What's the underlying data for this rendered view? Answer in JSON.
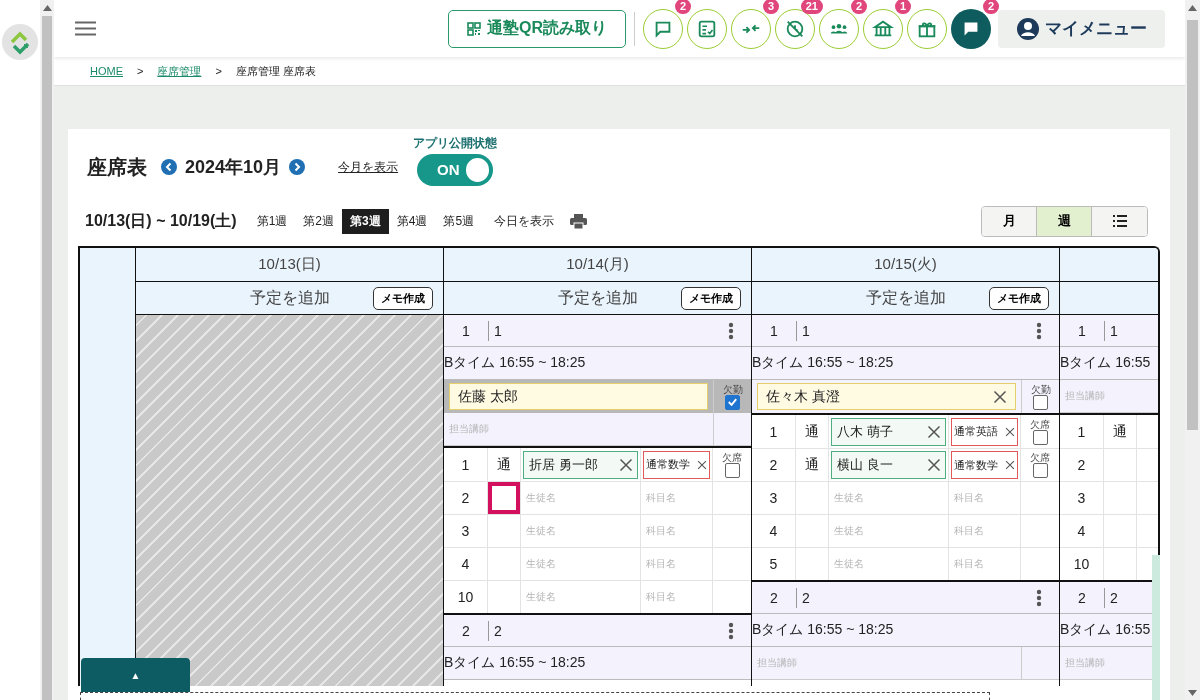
{
  "header": {
    "qr_button": "通塾QR読み取り",
    "icon_buttons": [
      {
        "kind": "outline",
        "badge": "2"
      },
      {
        "kind": "outline"
      },
      {
        "kind": "outline",
        "badge": "3"
      },
      {
        "kind": "outline",
        "badge": "21"
      },
      {
        "kind": "outline",
        "badge": "2"
      },
      {
        "kind": "outline",
        "badge": "1"
      },
      {
        "kind": "outline"
      },
      {
        "kind": "filled",
        "badge": "2"
      }
    ],
    "my_menu": "マイメニュー"
  },
  "breadcrumb": [
    {
      "kind": "link",
      "text": "HOME"
    },
    {
      "kind": "separator",
      "text": ">"
    },
    {
      "kind": "link",
      "text": "座席管理"
    },
    {
      "kind": "separator",
      "text": ">"
    },
    {
      "kind": "current",
      "text": "座席管理 座席表"
    }
  ],
  "page": {
    "title": "座席表",
    "month": "2024年10月",
    "this_month_link": "今月を表示",
    "publish": {
      "label": "アプリ公開状態",
      "on": true,
      "text": "ON"
    }
  },
  "week_bar": {
    "range": "10/13(日) ~ 10/19(土)",
    "weeks": [
      {
        "label": "第1週",
        "selected": false
      },
      {
        "label": "第2週",
        "selected": false
      },
      {
        "label": "第3週",
        "selected": true
      },
      {
        "label": "第4週",
        "selected": false
      },
      {
        "label": "第5週",
        "selected": false
      }
    ],
    "today_link": "今日を表示",
    "views": [
      {
        "kind": "text",
        "label": "月",
        "selected": false
      },
      {
        "kind": "text",
        "label": "週",
        "selected": true
      },
      {
        "kind": "icon",
        "selected": false
      }
    ]
  },
  "table": {
    "days": [
      {
        "date": "10/13(日)",
        "add_label": "予定を追加",
        "memo_button": "メモ作成",
        "closed": true
      },
      {
        "date": "10/14(月)",
        "add_label": "予定を追加",
        "memo_button": "メモ作成",
        "closed": false,
        "rows": [
          {
            "kind": "slot",
            "number": "1",
            "name": "1",
            "menu": true
          },
          {
            "kind": "time",
            "text": "Bタイム 16:55 ~ 18:25"
          },
          {
            "kind": "teacher",
            "name": "佐藤 太郎",
            "clear": false,
            "absence_label": "欠勤",
            "absent": true
          },
          {
            "kind": "teacher-placeholder",
            "placeholder": "担当講師"
          },
          {
            "kind": "student",
            "number": "1",
            "type": "通",
            "student": "折居 勇一郎",
            "subject": "通常数学",
            "absence_label": "欠席",
            "absent": false,
            "focused": false
          },
          {
            "kind": "student",
            "number": "2",
            "student_placeholder": "生徒名",
            "subject_placeholder": "科目名",
            "focused": true
          },
          {
            "kind": "student",
            "number": "3",
            "student_placeholder": "生徒名",
            "subject_placeholder": "科目名",
            "focused": false
          },
          {
            "kind": "student",
            "number": "4",
            "student_placeholder": "生徒名",
            "subject_placeholder": "科目名",
            "focused": false
          },
          {
            "kind": "student",
            "number": "10",
            "student_placeholder": "生徒名",
            "subject_placeholder": "科目名",
            "focused": false
          },
          {
            "kind": "slot",
            "number": "2",
            "name": "2",
            "menu": true
          },
          {
            "kind": "time",
            "text": "Bタイム 16:55 ~ 18:25"
          }
        ]
      },
      {
        "date": "10/15(火)",
        "add_label": "予定を追加",
        "memo_button": "メモ作成",
        "closed": false,
        "rows": [
          {
            "kind": "slot",
            "number": "1",
            "name": "1",
            "menu": true
          },
          {
            "kind": "time",
            "text": "Bタイム 16:55 ~ 18:25"
          },
          {
            "kind": "teacher",
            "name": "佐々木 真澄",
            "clear": true,
            "absence_label": "欠勤",
            "absent": false
          },
          {
            "kind": "student",
            "number": "1",
            "type": "通",
            "student": "八木 萌子",
            "subject": "通常英語",
            "absence_label": "欠席",
            "absent": false,
            "focused": false
          },
          {
            "kind": "student",
            "number": "2",
            "type": "通",
            "student": "横山 良一",
            "subject": "通常数学",
            "absence_label": "欠席",
            "absent": false,
            "focused": false
          },
          {
            "kind": "student",
            "number": "3",
            "student_placeholder": "生徒名",
            "subject_placeholder": "科目名",
            "focused": false
          },
          {
            "kind": "student",
            "number": "4",
            "student_placeholder": "生徒名",
            "subject_placeholder": "科目名",
            "focused": false
          },
          {
            "kind": "student",
            "number": "5",
            "student_placeholder": "生徒名",
            "subject_placeholder": "科目名",
            "focused": false
          },
          {
            "kind": "slot",
            "number": "2",
            "name": "2",
            "menu": true
          },
          {
            "kind": "time",
            "text": "Bタイム 16:55 ~ 18:25"
          },
          {
            "kind": "teacher-placeholder",
            "placeholder": "担当講師"
          }
        ]
      },
      {
        "closed": false,
        "rows": [
          {
            "kind": "slot",
            "number": "1",
            "name": "1"
          },
          {
            "kind": "time",
            "text": "Bタイム 16:55"
          },
          {
            "kind": "teacher-placeholder",
            "placeholder": "担当講師"
          },
          {
            "kind": "student",
            "number": "1",
            "type": "通",
            "focused": false
          },
          {
            "kind": "student",
            "number": "2",
            "focused": false
          },
          {
            "kind": "student",
            "number": "3",
            "focused": false
          },
          {
            "kind": "student",
            "number": "4",
            "focused": false
          },
          {
            "kind": "student",
            "number": "10",
            "focused": false
          },
          {
            "kind": "slot",
            "number": "2",
            "name": "2"
          },
          {
            "kind": "time",
            "text": "Bタイム 16:55"
          },
          {
            "kind": "teacher-placeholder",
            "placeholder": "担当講師"
          }
        ]
      }
    ]
  },
  "drawer": {
    "toggle": "▲"
  }
}
